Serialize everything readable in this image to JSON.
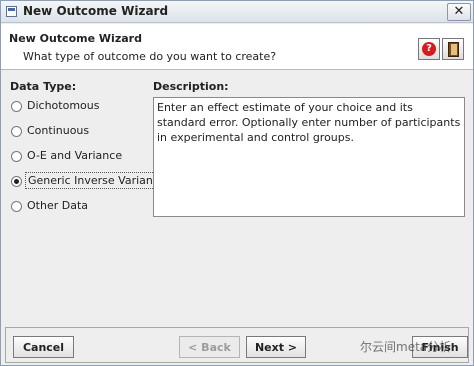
{
  "window": {
    "title": "New Outcome Wizard",
    "close_glyph": "✕"
  },
  "header": {
    "title": "New Outcome Wizard",
    "subtitle": "What type of outcome do you want to create?",
    "help_glyph": "?"
  },
  "data_type": {
    "label": "Data Type:",
    "options": [
      {
        "label": "Dichotomous",
        "selected": false
      },
      {
        "label": "Continuous",
        "selected": false
      },
      {
        "label": "O-E and Variance",
        "selected": false
      },
      {
        "label": "Generic Inverse Variance",
        "selected": true
      },
      {
        "label": "Other Data",
        "selected": false
      }
    ]
  },
  "description": {
    "label": "Description:",
    "text": "Enter an effect estimate of your choice and its standard error. Optionally enter number of participants in experimental and control groups."
  },
  "buttons": {
    "cancel": "Cancel",
    "back": "< Back",
    "next": "Next >",
    "finish": "Finish"
  },
  "watermark": "尔云间meta分析",
  "icons": [
    "window-icon",
    "close-icon",
    "help-icon",
    "manual-book-icon",
    "radio-icon"
  ]
}
